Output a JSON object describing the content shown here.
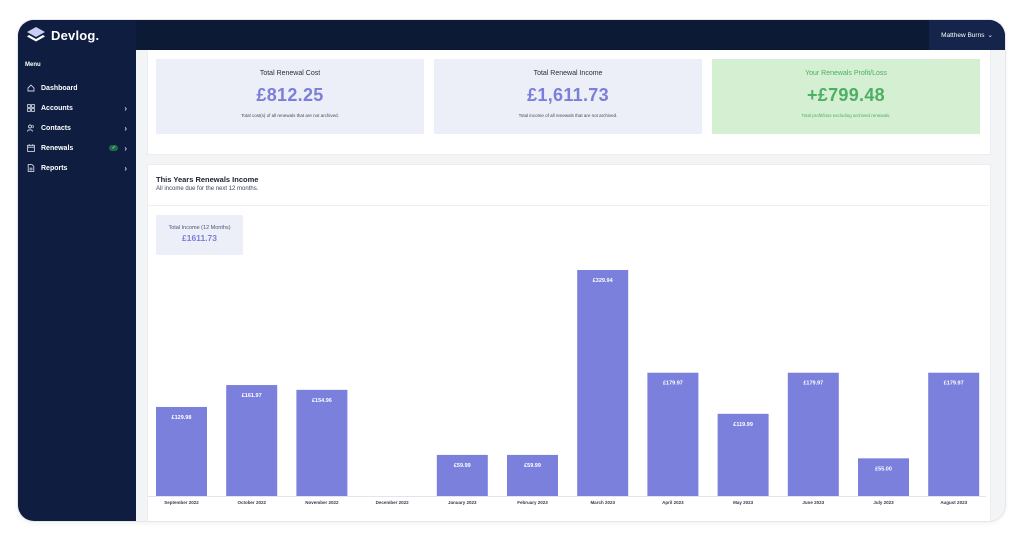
{
  "app": {
    "brand": "Devlog.",
    "user_name": "Matthew Burns"
  },
  "sidebar": {
    "heading": "Menu",
    "items": [
      {
        "label": "Dashboard",
        "icon": "home-icon",
        "chevron": false,
        "badge": false
      },
      {
        "label": "Accounts",
        "icon": "grid-icon",
        "chevron": true,
        "badge": false
      },
      {
        "label": "Contacts",
        "icon": "users-icon",
        "chevron": true,
        "badge": false
      },
      {
        "label": "Renewals",
        "icon": "calendar-icon",
        "chevron": true,
        "badge": true
      },
      {
        "label": "Reports",
        "icon": "document-icon",
        "chevron": true,
        "badge": false
      }
    ]
  },
  "stats": {
    "cost": {
      "title": "Total Renewal Cost",
      "value": "£812.25",
      "desc": "Total cost(s) of all renewals that are not archived."
    },
    "income": {
      "title": "Total Renewal Income",
      "value": "£1,611.73",
      "desc": "Total income of all renewals that are not archived."
    },
    "profit": {
      "title": "Your Renewals Profit/Loss",
      "value": "+£799.48",
      "desc": "Total profit/loss excluding archived renewals."
    }
  },
  "chart_section": {
    "title": "This Years Renewals Income",
    "subtitle": "All income due for the next 12 months.",
    "total_label": "Total Income (12 Months)",
    "total_value": "£1611.73"
  },
  "colors": {
    "accent": "#7a7fd9",
    "bar": "#7b80dc",
    "sidebar": "#0e1d40",
    "topbar": "#0d1a36",
    "profit_bg": "#d4efd2",
    "profit_text": "#4caf63",
    "stat_bg": "#eceef8"
  },
  "chart_data": {
    "type": "bar",
    "categories": [
      "September 2022",
      "October 2022",
      "November 2022",
      "December 2022",
      "January 2023",
      "February 2023",
      "March 2023",
      "April 2023",
      "May 2023",
      "June 2023",
      "July 2023",
      "August 2023"
    ],
    "values": [
      129.98,
      161.97,
      154.96,
      0,
      59.99,
      59.99,
      329.94,
      179.97,
      119.99,
      179.97,
      55.0,
      179.97
    ],
    "labels": [
      "£129.98",
      "£161.97",
      "£154.96",
      "",
      "£59.99",
      "£59.99",
      "£329.94",
      "£179.97",
      "£119.99",
      "£179.97",
      "£55.00",
      "£179.97"
    ],
    "ylim": [
      0,
      329.94
    ],
    "grid": false,
    "legend": "none"
  }
}
